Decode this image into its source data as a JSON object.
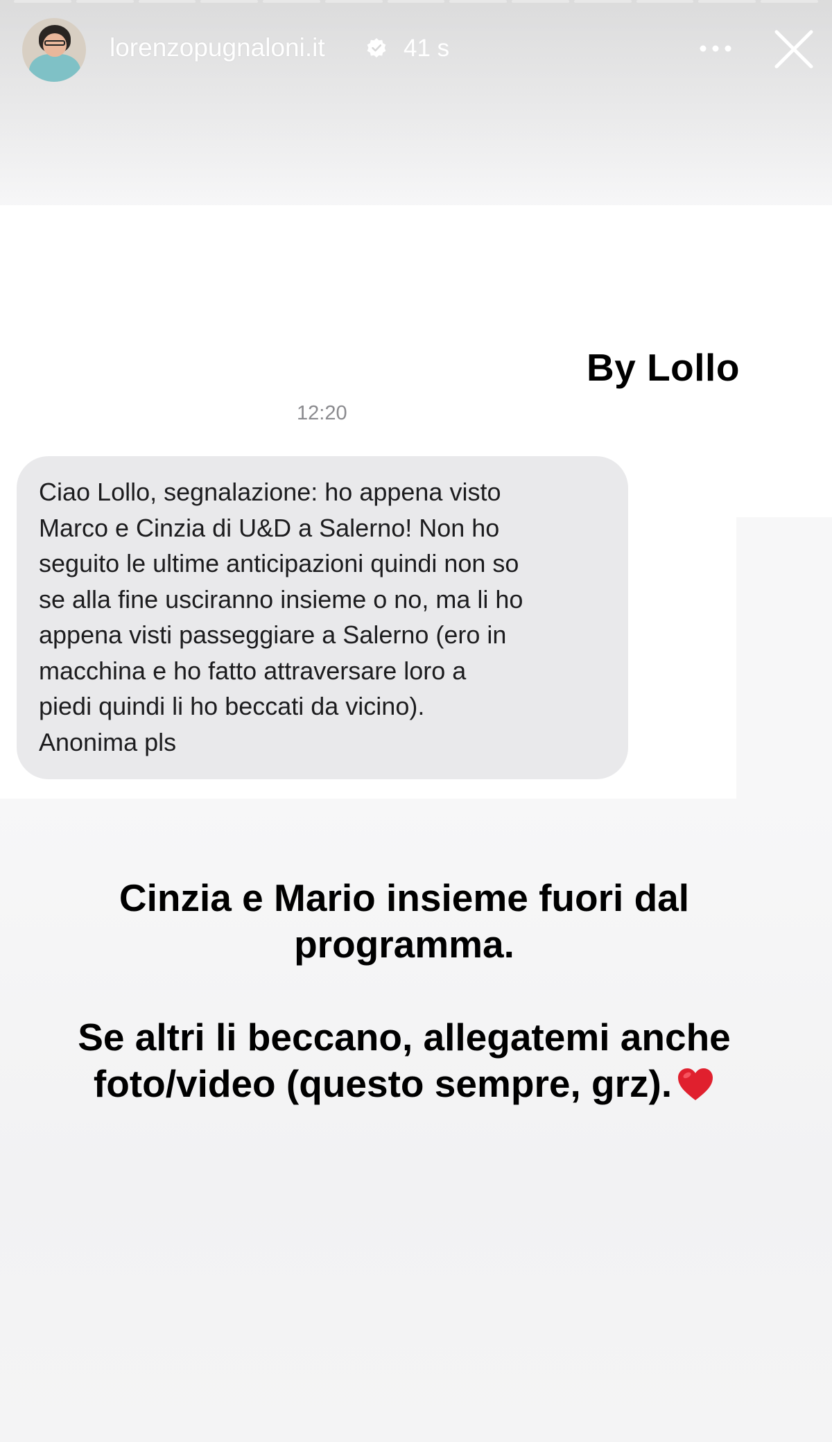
{
  "story": {
    "segment_count": 13,
    "segments_completed": 13
  },
  "header": {
    "username": "lorenzopugnaloni.it",
    "verified": true,
    "time_ago": "41 s",
    "avatar_icon": "profile-photo",
    "more_icon": "ellipsis-icon",
    "close_icon": "close-icon"
  },
  "content": {
    "signature": "By Lollo",
    "message_time": "12:20",
    "message_text": "Ciao Lollo, segnalazione: ho appena visto\nMarco e Cinzia di U&D a Salerno! Non ho\nseguito le ultime anticipazioni quindi non so\nse alla fine usciranno insieme o no, ma li ho\nappena visti passeggiare a Salerno (ero in\nmacchina e ho fatto attraversare loro a\npiedi quindi li ho beccati da vicino).\nAnonima pls",
    "caption_line1": "Cinzia e Mario insieme fuori dal programma.",
    "caption_line2": "Se altri li beccano, allegatemi anche foto/video (questo sempre, grz).",
    "heart_emoji": "❤️"
  },
  "colors": {
    "bubble": "#e9e9eb",
    "heart": "#e0202e",
    "verified": "#ffffff"
  }
}
